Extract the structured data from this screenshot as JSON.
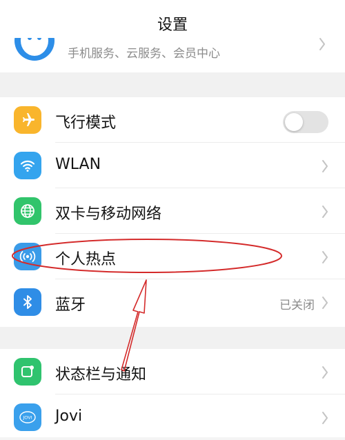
{
  "header": {
    "title": "设置"
  },
  "account": {
    "subtitle": "手机服务、云服务、会员中心"
  },
  "settings_group_1": [
    {
      "label": "飞行模式",
      "icon": "airplane-icon",
      "color": "#f9b52c",
      "control": "toggle",
      "toggle_on": false
    },
    {
      "label": "WLAN",
      "icon": "wifi-icon",
      "color": "#34a4ee",
      "control": "chevron"
    },
    {
      "label": "双卡与移动网络",
      "icon": "globe-icon",
      "color": "#31c46b",
      "control": "chevron"
    },
    {
      "label": "个人热点",
      "icon": "hotspot-icon",
      "color": "#3a9be8",
      "control": "chevron"
    },
    {
      "label": "蓝牙",
      "icon": "bluetooth-icon",
      "color": "#2f8de6",
      "control": "chevron",
      "status": "已关闭"
    }
  ],
  "settings_group_2": [
    {
      "label": "状态栏与通知",
      "icon": "notification-icon",
      "color": "#2fc36e",
      "control": "chevron"
    },
    {
      "label": "Jovi",
      "icon": "jovi-icon",
      "color": "#3aa0ec",
      "control": "chevron",
      "icon_text": "JOVI"
    }
  ],
  "colors": {
    "annotation": "#d42a2a"
  }
}
